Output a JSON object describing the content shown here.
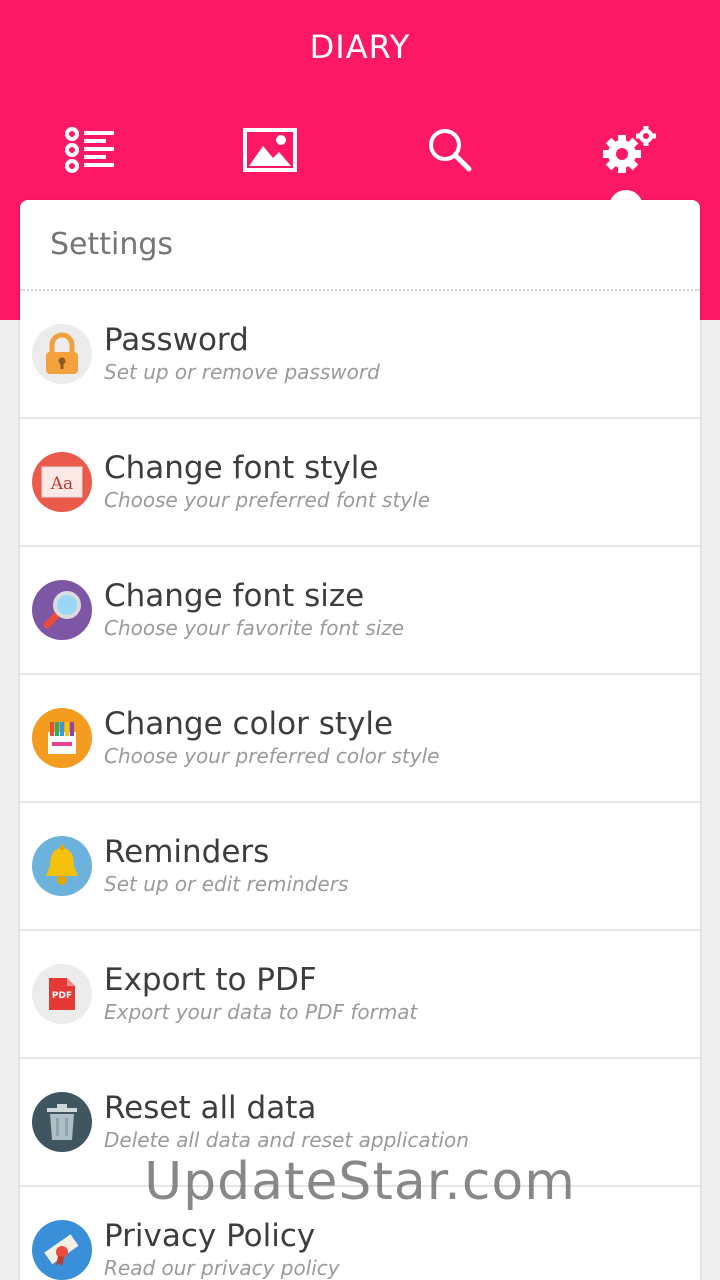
{
  "app": {
    "title": "DIARY"
  },
  "tabs": [
    {
      "name": "list-icon"
    },
    {
      "name": "image-icon"
    },
    {
      "name": "search-icon"
    },
    {
      "name": "gears-icon",
      "active": true
    }
  ],
  "colors": {
    "brand": "#fc1864",
    "background": "#efefef"
  },
  "settings": {
    "title": "Settings",
    "items": [
      {
        "title": "Password",
        "subtitle": "Set up or remove password",
        "icon": "lock-icon"
      },
      {
        "title": "Change font style",
        "subtitle": "Choose your preferred font style",
        "icon": "font-style-icon"
      },
      {
        "title": "Change font size",
        "subtitle": "Choose your favorite font size",
        "icon": "magnifier-icon"
      },
      {
        "title": "Change color style",
        "subtitle": "Choose your preferred color style",
        "icon": "palette-icon"
      },
      {
        "title": "Reminders",
        "subtitle": "Set up or edit reminders",
        "icon": "bell-icon"
      },
      {
        "title": "Export to PDF",
        "subtitle": "Export your data to PDF format",
        "icon": "pdf-icon",
        "icon_label": "PDF"
      },
      {
        "title": "Reset all data",
        "subtitle": "Delete all data and reset application",
        "icon": "trash-icon"
      },
      {
        "title": "Privacy Policy",
        "subtitle": "Read our privacy policy",
        "icon": "scroll-icon"
      }
    ]
  },
  "watermark": {
    "text": "UpdateStar.com"
  }
}
